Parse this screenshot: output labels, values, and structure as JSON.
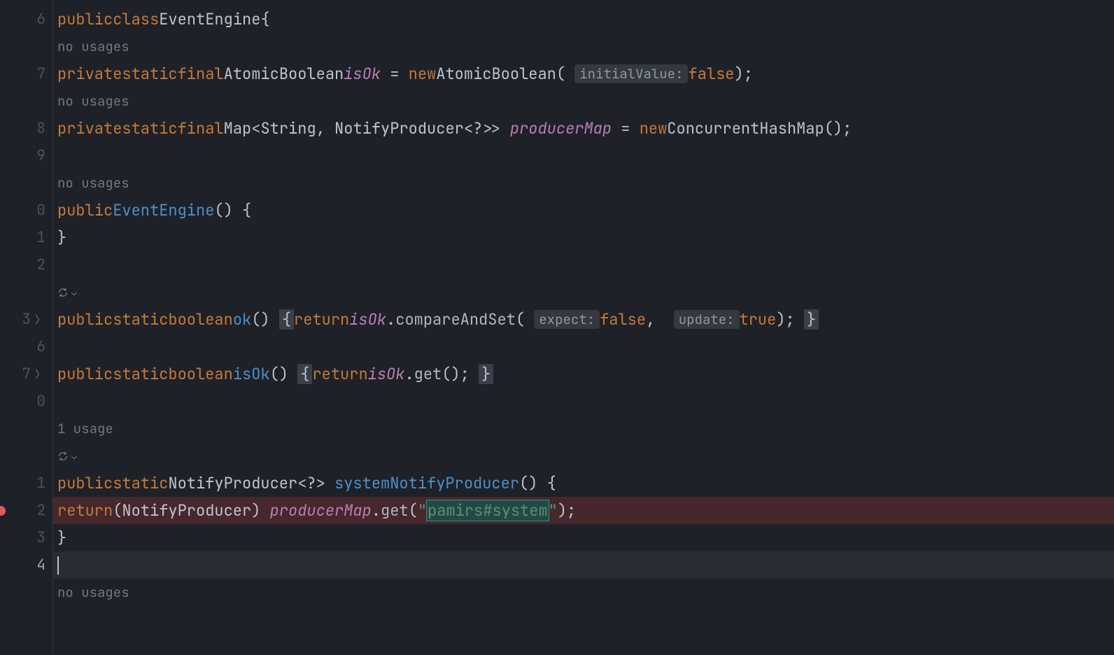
{
  "gutter": {
    "lines": [
      "6",
      "",
      "7",
      "",
      "8",
      "9",
      "",
      "0",
      "1",
      "2",
      "",
      "3",
      "6",
      "7",
      "0",
      "",
      "",
      "1",
      "2",
      "3",
      "4",
      ""
    ],
    "foldAt": [
      11,
      13
    ],
    "breakpointAt": 18,
    "currentAt": 20
  },
  "hints": {
    "no_usages": "no usages",
    "one_usage": "1 usage",
    "initialValue": "initialValue:",
    "expect": "expect:",
    "update": "update:"
  },
  "tokens": {
    "public": "public",
    "class": "class",
    "EventEngine": "EventEngine",
    "private": "private",
    "static": "static",
    "final": "final",
    "AtomicBoolean": "AtomicBoolean",
    "isOk_field": "isOk",
    "eq": " = ",
    "new": "new",
    "false": "false",
    "true": "true",
    "Map": "Map",
    "String": "String",
    "NotifyProducer": "NotifyProducer",
    "producerMap": "producerMap",
    "ConcurrentHashMap": "ConcurrentHashMap",
    "boolean": "boolean",
    "ok": "ok",
    "isOk_method": "isOk",
    "return": "return",
    "compareAndSet": "compareAndSet",
    "get": "get",
    "systemNotifyProducer": "systemNotifyProducer",
    "string_literal": "pamirs#system"
  }
}
